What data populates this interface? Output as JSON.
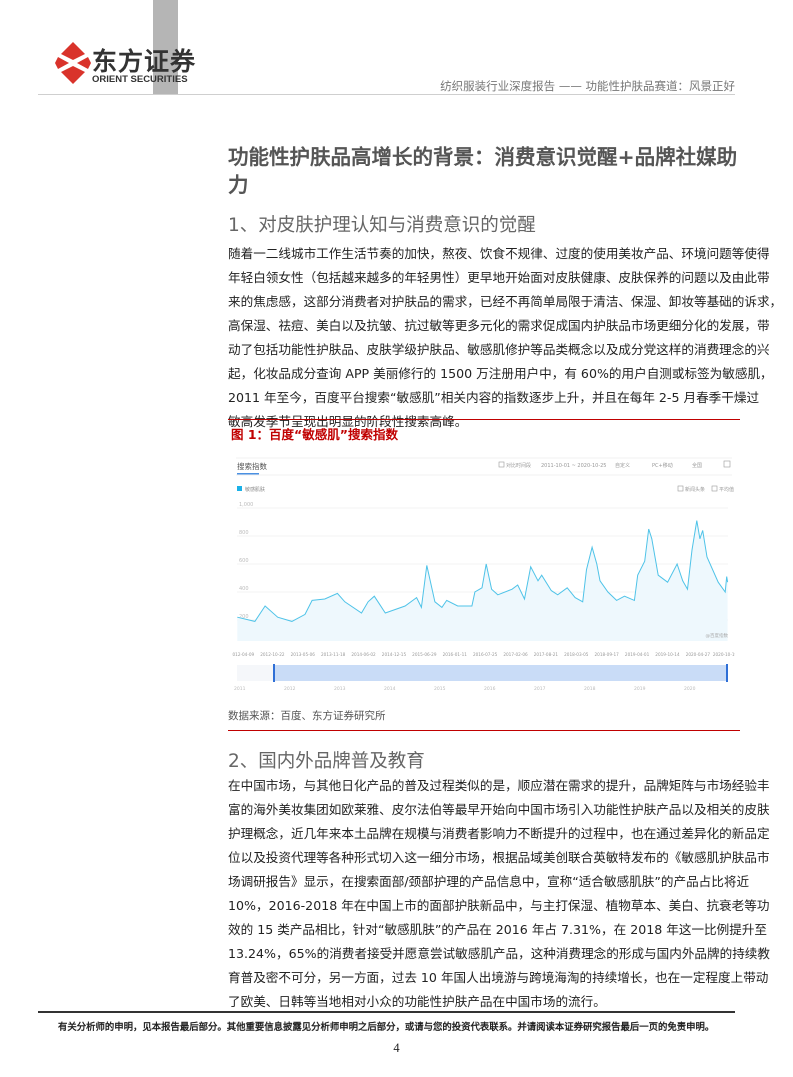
{
  "header": {
    "logo_cn": "东方证券",
    "logo_en": "ORIENT SECURITIES",
    "report_title": "纺织服装行业深度报告 —— 功能性护肤品赛道：风景正好",
    "brand_color": "#d9332b"
  },
  "title": "功能性护肤品高增长的背景：消费意识觉醒+品牌社媒助力",
  "section1": {
    "heading": "1、对皮肤护理认知与消费意识的觉醒",
    "lines": [
      "随着一二线城市工作生活节奏的加快，熬夜、饮食不规律、过度的使用美妆产品、环境问题等使得",
      "年轻白领女性（包括越来越多的年轻男性）更早地开始面对皮肤健康、皮肤保养的问题以及由此带",
      "来的焦虑感，这部分消费者对护肤品的需求，已经不再简单局限于清洁、保湿、卸妆等基础的诉求，",
      "高保湿、祛痘、美白以及抗皱、抗过敏等更多元化的需求促成国内护肤品市场更细分化的发展，带",
      "动了包括功能性护肤品、皮肤学级护肤品、敏感肌修护等品类概念以及成分党这样的消费理念的兴",
      "起，化妆品成分查询 APP 美丽修行的 1500 万注册用户中，有 60%的用户自测或标签为敏感肌，",
      "2011 年至今，百度平台搜索“敏感肌”相关内容的指数逐步上升，并且在每年 2-5 月春季干燥过",
      "敏高发季节呈现出明显的阶段性搜索高峰。"
    ]
  },
  "figure1": {
    "title": "图 1：百度“敏感肌”搜索指数",
    "source": "数据来源：百度、东方证券研究所",
    "toolbar": {
      "tab": "搜索指数",
      "compare_checkbox": "对比时间段",
      "date_range": "2011-10-01 ~ 2020-10-25",
      "custom": "自定义",
      "device": "PC+移动",
      "region": "全国"
    },
    "legend_options": [
      "新闻头条",
      "平均值"
    ],
    "watermark": "@百度指数"
  },
  "chart_data": {
    "type": "area",
    "series": [
      {
        "name": "敏感肌肤",
        "color": "#4fc3e8",
        "points": [
          [
            "2012-03-10",
            220
          ],
          [
            "2012-07-01",
            190
          ],
          [
            "2012-09-05",
            300
          ],
          [
            "2012-11-25",
            220
          ],
          [
            "2013-02-25",
            190
          ],
          [
            "2013-05-20",
            240
          ],
          [
            "2013-07-05",
            340
          ],
          [
            "2013-09-25",
            350
          ],
          [
            "2013-12-15",
            390
          ],
          [
            "2014-02-01",
            330
          ],
          [
            "2014-05-20",
            250
          ],
          [
            "2014-07-01",
            330
          ],
          [
            "2014-08-10",
            370
          ],
          [
            "2014-10-20",
            250
          ],
          [
            "2015-02-25",
            300
          ],
          [
            "2015-05-10",
            360
          ],
          [
            "2015-06-10",
            290
          ],
          [
            "2015-07-15",
            590
          ],
          [
            "2015-09-05",
            330
          ],
          [
            "2015-10-20",
            290
          ],
          [
            "2015-11-20",
            340
          ],
          [
            "2016-01-30",
            300
          ],
          [
            "2016-05-01",
            300
          ],
          [
            "2016-05-20",
            400
          ],
          [
            "2016-07-05",
            430
          ],
          [
            "2016-08-01",
            600
          ],
          [
            "2016-09-05",
            420
          ],
          [
            "2016-10-15",
            380
          ],
          [
            "2017-01-15",
            420
          ],
          [
            "2017-02-20",
            450
          ],
          [
            "2017-04-05",
            350
          ],
          [
            "2017-05-15",
            580
          ],
          [
            "2017-07-01",
            480
          ],
          [
            "2017-07-25",
            520
          ],
          [
            "2017-09-25",
            410
          ],
          [
            "2017-11-05",
            380
          ],
          [
            "2018-01-05",
            430
          ],
          [
            "2018-02-25",
            360
          ],
          [
            "2018-04-15",
            330
          ],
          [
            "2018-05-10",
            560
          ],
          [
            "2018-06-15",
            720
          ],
          [
            "2018-07-15",
            600
          ],
          [
            "2018-08-05",
            480
          ],
          [
            "2018-09-25",
            400
          ],
          [
            "2018-11-20",
            340
          ],
          [
            "2019-01-10",
            370
          ],
          [
            "2019-03-15",
            340
          ],
          [
            "2019-04-05",
            520
          ],
          [
            "2019-05-20",
            620
          ],
          [
            "2019-06-15",
            850
          ],
          [
            "2019-07-05",
            780
          ],
          [
            "2019-08-15",
            520
          ],
          [
            "2019-10-15",
            470
          ],
          [
            "2019-12-15",
            600
          ],
          [
            "2020-01-20",
            480
          ],
          [
            "2020-02-20",
            420
          ],
          [
            "2020-03-20",
            700
          ],
          [
            "2020-04-20",
            910
          ],
          [
            "2020-05-10",
            780
          ],
          [
            "2020-05-28",
            840
          ],
          [
            "2020-06-25",
            650
          ],
          [
            "2020-09-05",
            470
          ],
          [
            "2020-10-20",
            400
          ],
          [
            "2020-10-30",
            510
          ],
          [
            "2020-11-05",
            470
          ]
        ]
      }
    ],
    "yticks": [
      "1,000",
      "800",
      "600",
      "400",
      "200"
    ],
    "ytick_values": [
      1000,
      800,
      600,
      400,
      200
    ],
    "ylim": [
      0,
      1000
    ],
    "xticks": [
      "2012-04-09",
      "2012-10-22",
      "2013-05-06",
      "2013-11-18",
      "2014-06-02",
      "2014-12-15",
      "2015-06-29",
      "2016-01-11",
      "2016-07-25",
      "2017-02-06",
      "2017-08-21",
      "2018-03-05",
      "2018-09-17",
      "2019-04-01",
      "2019-10-14",
      "2020-04-27",
      "2020-10-19"
    ],
    "slider_years": [
      "2011",
      "2012",
      "2013",
      "2014",
      "2015",
      "2016",
      "2017",
      "2018",
      "2019",
      "2020"
    ],
    "grid": true
  },
  "section2": {
    "heading": "2、国内外品牌普及教育",
    "lines": [
      "在中国市场，与其他日化产品的普及过程类似的是，顺应潜在需求的提升，品牌矩阵与市场经验丰",
      "富的海外美妆集团如欧莱雅、皮尔法伯等最早开始向中国市场引入功能性护肤产品以及相关的皮肤",
      "护理概念，近几年来本土品牌在规模与消费者影响力不断提升的过程中，也在通过差异化的新品定",
      "位以及投资代理等各种形式切入这一细分市场，根据品域美创联合英敏特发布的《敏感肌护肤品市",
      "场调研报告》显示，在搜索面部/颈部护理的产品信息中，宣称“适合敏感肌肤”的产品占比将近",
      "10%，2016-2018 年在中国上市的面部护肤新品中，与主打保湿、植物草本、美白、抗衰老等功",
      "效的 15 类产品相比，针对“敏感肌肤”的产品在 2016 年占 7.31%，在 2018 年这一比例提升至",
      "13.24%，65%的消费者接受并愿意尝试敏感肌产品，这种消费理念的形成与国内外品牌的持续教",
      "育普及密不可分，另一方面，过去 10 年国人出境游与跨境海淘的持续增长，也在一定程度上带动",
      "了欧美、日韩等当地相对小众的功能性护肤产品在中国市场的流行。"
    ]
  },
  "footer": {
    "disclaimer": "有关分析师的申明，见本报告最后部分。其他重要信息披露见分析师申明之后部分，或请与您的投资代表联系。并请阅读本证券研究报告最后一页的免责申明。",
    "page_number": "4"
  }
}
